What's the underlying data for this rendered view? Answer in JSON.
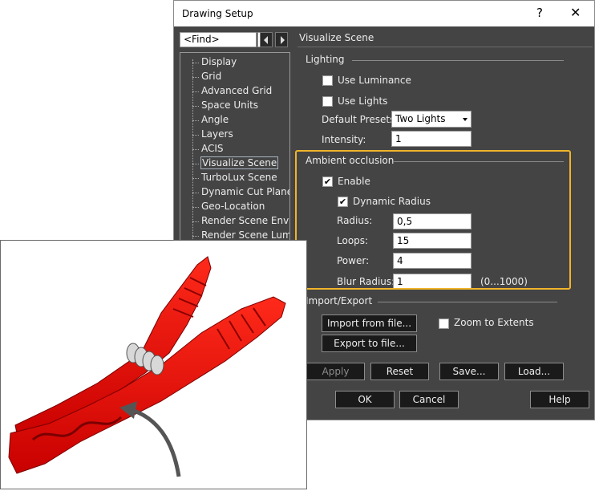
{
  "dialog": {
    "title": "Drawing Setup",
    "help_glyph": "?",
    "close_glyph": "✕",
    "find_value": "<Find>",
    "section_title": "Visualize Scene"
  },
  "tree": {
    "items": [
      "Display",
      "Grid",
      "Advanced Grid",
      "Space Units",
      "Angle",
      "Layers",
      "ACIS",
      "Visualize Scene",
      "TurboLux Scene",
      "Dynamic Cut Plane",
      "Geo-Location",
      "Render Scene Environ",
      "Render Scene Lumina"
    ],
    "selected": "Visualize Scene"
  },
  "lighting": {
    "heading": "Lighting",
    "use_luminance": "Use Luminance",
    "use_lights": "Use Lights",
    "presets_label": "Default Presets:",
    "presets_value": "Two Lights",
    "intensity_label": "Intensity:",
    "intensity_value": "1"
  },
  "ambient": {
    "heading": "Ambient occlusion",
    "enable": "Enable",
    "dynamic_radius": "Dynamic Radius",
    "radius_label": "Radius:",
    "radius_value": "0,5",
    "loops_label": "Loops:",
    "loops_value": "15",
    "power_label": "Power:",
    "power_value": "4",
    "blur_label": "Blur Radius:",
    "blur_value": "1",
    "blur_range": "(0...1000)",
    "highlight_color": "#f0b429"
  },
  "import_export": {
    "heading": "Import/Export",
    "import_button": "Import from file...",
    "export_button": "Export to file...",
    "zoom_extents": "Zoom to Extents"
  },
  "actions": {
    "apply": "Apply",
    "reset": "Reset",
    "save": "Save...",
    "load": "Load...",
    "ok": "OK",
    "cancel": "Cancel",
    "help": "Help"
  },
  "image": {
    "subject": "red clothespin render",
    "accent": "#e00000"
  }
}
